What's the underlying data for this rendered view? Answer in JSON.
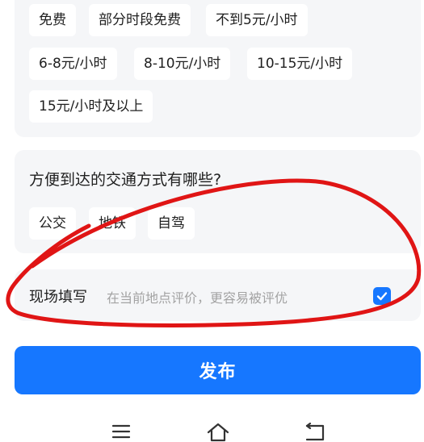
{
  "fees": {
    "options": [
      "免费",
      "部分时段免费",
      "不到5元/小时",
      "6-8元/小时",
      "8-10元/小时",
      "10-15元/小时",
      "15元/小时及以上"
    ]
  },
  "transport": {
    "question": "方便到达的交通方式有哪些?",
    "options": [
      "公交",
      "地铁",
      "自驾"
    ]
  },
  "onsite": {
    "label": "现场填写",
    "hint": "在当前地点评价，更容易被评优"
  },
  "publish": {
    "label": "发布"
  },
  "navbar": {
    "icons": [
      "menu-icon",
      "home-icon",
      "back-icon"
    ]
  },
  "colors": {
    "accent": "#1677ff",
    "card_bg": "#f5f6f8",
    "annotation": "#e01515"
  }
}
